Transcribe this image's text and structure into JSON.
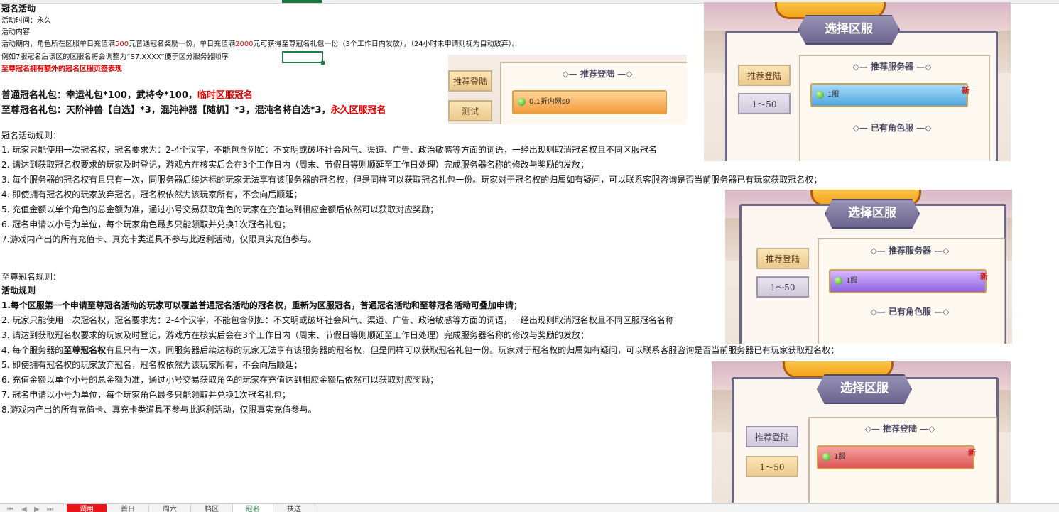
{
  "header": {
    "title": "冠名活动"
  },
  "info": {
    "time": "活动时间：永久",
    "content_label": "活动内容",
    "desc_prefix": "活动期内，角色所在区服单日充值满",
    "desc_amount1": "500",
    "desc_mid": "元普通冠名奖励一份，单日充值满",
    "desc_amount2": "2000",
    "desc_suffix": "元可获得至尊冠名礼包一份（3个工作日内发放），（24小时未申请则视为自动放弃）。",
    "example": "例如7服冠名后该区的区服名将会调整为“S7.XXXX”便于区分服务器顺序",
    "red_note": "至尊冠名拥有额外的冠名区服页签表现"
  },
  "gifts": {
    "normal_prefix": "普通冠名礼包：幸运礼包*100，武将令*100，",
    "normal_tag": "临时区服冠名",
    "supreme_prefix": "至尊冠名礼包：天阶神兽【自选】*3，混沌神器【随机】*3，混沌名将自选*3，",
    "supreme_tag": "永久区服冠名"
  },
  "rules1": {
    "title": "冠名活动规则：",
    "items": [
      "1. 玩家只能使用一次冠名权，冠名要求为：2-4个汉字，不能包含例如：不文明或破坏社会风气、渠道、广告、政治敏感等方面的词语，一经出现则取消冠名权且不同区服冠名",
      "2. 请达到获取冠名权要求的玩家及时登记，游戏方在核实后会在3个工作日内（周末、节假日等则顺延至工作日处理）完成服务器名称的修改与奖励的发放；",
      "3. 每个服务器的冠名权有且只有一次，同服务器后续达标的玩家无法享有该服务器的冠名权，但是同样可以获取冠名礼包一份。玩家对于冠名权的归属如有疑问，可以联系客服咨询是否当前服务器已有玩家获取冠名权；",
      "4. 即使拥有冠名权的玩家放弃冠名，冠名权依然为该玩家所有，不会向后顺延；",
      "5. 充值金额以单个角色的总金额为准，通过小号交易获取角色的玩家在充值达到相应金额后依然可以获取对应奖励；",
      "6. 冠名申请以小号为单位，每个玩家角色最多只能领取并兑换1次冠名礼包；",
      "7.游戏内产出的所有充值卡、真充卡类道具不参与此返利活动，仅限真实充值参与。"
    ]
  },
  "rules2": {
    "title": "至尊冠名规则：",
    "subtitle": "活动规则",
    "first": "1.每个区服第一个申请至尊冠名活动的玩家可以覆盖普通冠名活动的冠名权，重新为区服冠名，普通冠名活动和至尊冠名活动可叠加申请；",
    "items": [
      "2. 玩家只能使用一次冠名权，冠名要求为：2-4个汉字，不能包含例如：不文明或破坏社会风气、渠道、广告、政治敏感等方面的词语，一经出现则取消冠名权且不同区服冠名名称",
      "3. 请达到获取冠名权要求的玩家及时登记，游戏方在核实后会在3个工作日内（周末、节假日等则顺延至工作日处理）完成服务器名称的修改与奖励的发放；"
    ],
    "item4_prefix": "4. 每个服务器的",
    "item4_bold": "至尊冠名权",
    "item4_suffix": "有且只有一次，同服务器后续达标的玩家无法享有该服务器的冠名权，但是同样可以获取冠名礼包一份。玩家对于冠名权的归属如有疑问，可以联系客服咨询是否当前服务器已有玩家获取冠名权；",
    "items_rest": [
      "5. 即使拥有冠名权的玩家放弃冠名，冠名权依然为该玩家所有，不会向后顺延；",
      "6. 充值金额以单个小号的总金额为准，通过小号交易获取角色的玩家在充值达到相应金额后依然可以获取对应奖励；",
      "7. 冠名申请以小号为单位，每个玩家角色最多只能领取并兑换1次冠名礼包；",
      "8.游戏内产出的所有充值卡、真充卡类道具不参与此返利活动，仅限真实充值参与。"
    ]
  },
  "shot_small": {
    "heading": "推荐登陆",
    "btn1": "推荐登陆",
    "btn2": "测试",
    "server": "0.1折内网s0",
    "server_color": "#f5a623"
  },
  "shots": [
    {
      "title": "选择区服",
      "btn1": "推荐登陆",
      "btn2": "1～50",
      "heading1": "推荐服务器",
      "heading2": "已有角色服",
      "server": "1服",
      "badge": "新",
      "server_color": "#6fb9e6"
    },
    {
      "title": "选择区服",
      "btn1": "推荐登陆",
      "btn2": "1～50",
      "heading1": "推荐服务器",
      "heading2": "已有角色服",
      "server": "1服",
      "badge": "新",
      "server_color": "#a77de6"
    },
    {
      "title": "选择区服",
      "btn1": "推荐登陆",
      "btn2": "1～50",
      "heading1": "推荐登陆",
      "server": "1服",
      "badge": "新",
      "server_color": "#e86a6a"
    }
  ],
  "tabs": [
    {
      "label": "调用"
    },
    {
      "label": "首日"
    },
    {
      "label": "周六"
    },
    {
      "label": "档区"
    },
    {
      "label": "冠名"
    },
    {
      "label": "扶送"
    }
  ]
}
